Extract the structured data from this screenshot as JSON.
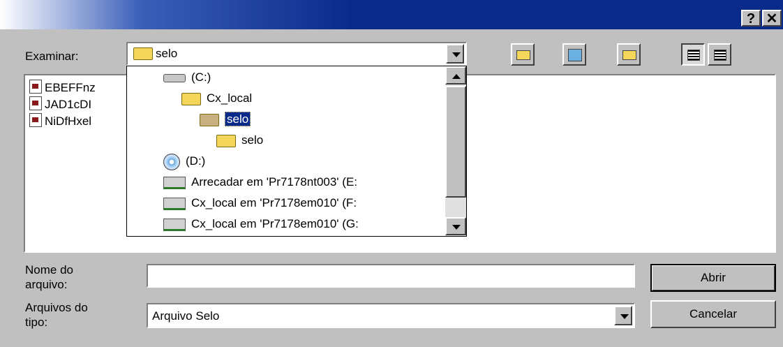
{
  "titlebar": {
    "help": "?",
    "close": "✕"
  },
  "look_in": {
    "label": "Examinar:",
    "value": "selo"
  },
  "files": [
    {
      "name": "EBEFFnz"
    },
    {
      "name": "JAD1cDI"
    },
    {
      "name": "NiDfHxel"
    }
  ],
  "dropdown": {
    "items": [
      {
        "label": "(C:)",
        "icon": "drive-icon"
      },
      {
        "label": "Cx_local",
        "icon": "folder-icon"
      },
      {
        "label": "selo",
        "icon": "folder-icon",
        "selected": true
      },
      {
        "label": "selo",
        "icon": "open-folder-icon"
      },
      {
        "label": "(D:)",
        "icon": "cd-drive-icon"
      },
      {
        "label": "Arrecadar em 'Pr7178nt003' (E:",
        "icon": "network-drive-icon"
      },
      {
        "label": "Cx_local em 'Pr7178em010' (F:",
        "icon": "network-drive-icon"
      },
      {
        "label": "Cx_local em 'Pr7178em010' (G:",
        "icon": "network-drive-icon"
      }
    ]
  },
  "filename": {
    "label_line1": "Nome do",
    "label_line2": "arquivo:",
    "value": ""
  },
  "filetype": {
    "label_line1": "Arquivos do",
    "label_line2": "tipo:",
    "value": "Arquivo Selo"
  },
  "buttons": {
    "open": "Abrir",
    "cancel": "Cancelar"
  }
}
